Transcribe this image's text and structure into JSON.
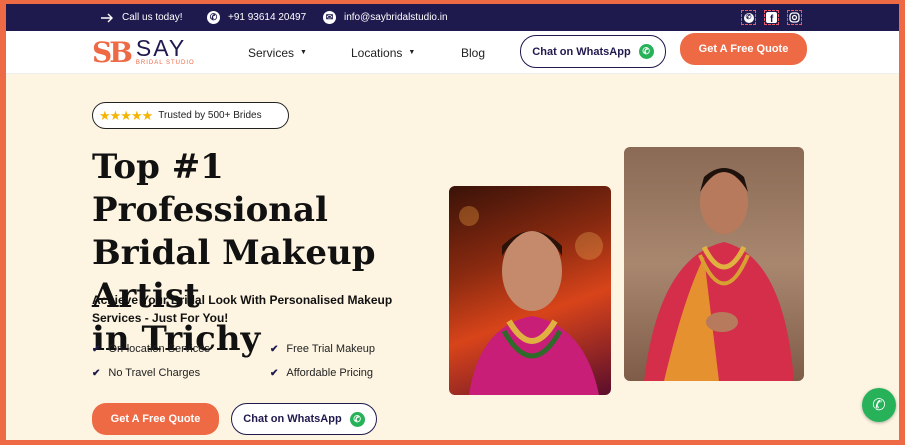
{
  "topbar": {
    "call_label": "Call us today!",
    "phone": "+91 93614 20497",
    "email": "info@saybridalstudio.in",
    "icons": [
      "arrow-right-icon",
      "phone-icon",
      "mail-icon",
      "whatsapp-icon",
      "facebook-icon",
      "instagram-icon"
    ]
  },
  "nav": {
    "logo_mark": "SB",
    "logo_name": "SAY",
    "logo_sub": "BRIDAL STUDIO",
    "services": "Services",
    "locations": "Locations",
    "blog": "Blog",
    "whatsapp_button": "Chat on WhatsApp",
    "quote_button": "Get A Free Quote"
  },
  "hero": {
    "trust_stars": "★★★★★",
    "trust_text": "Trusted by 500+ Brides",
    "headline_1": "Top #1 Professional",
    "headline_2": "Bridal Makeup Artist",
    "headline_3": "in Trichy",
    "subhead": "Achieve Your Bridal Look With Personalised Makeup Services - Just For You!",
    "features": [
      "On-location Services",
      "Free Trial Makeup",
      "No Travel Charges",
      "Affordable Pricing"
    ],
    "quote_button": "Get A Free Quote",
    "whatsapp_button": "Chat on WhatsApp"
  },
  "colors": {
    "brand_navy": "#1f1a4e",
    "accent_orange": "#ee6a45",
    "whatsapp_green": "#27b25a",
    "background_cream": "#fdf5e2"
  }
}
